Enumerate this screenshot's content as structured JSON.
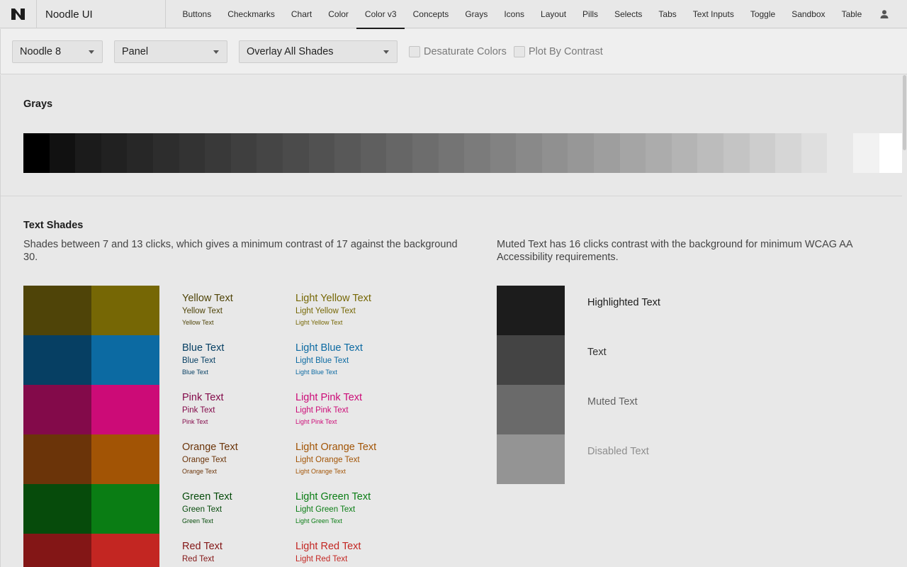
{
  "app": {
    "title": "Noodle UI",
    "logo_icon": "noodle-logo-icon"
  },
  "nav": {
    "tabs": [
      "Buttons",
      "Checkmarks",
      "Chart",
      "Color",
      "Color v3",
      "Concepts",
      "Grays",
      "Icons",
      "Layout",
      "Pills",
      "Selects",
      "Tabs",
      "Text Inputs",
      "Toggle",
      "Sandbox",
      "Table"
    ],
    "active": "Color v3",
    "user_icon": "user-icon"
  },
  "toolbar": {
    "theme_select": "Noodle 8",
    "surface_select": "Panel",
    "overlay_select": "Overlay All Shades",
    "desaturate_label": "Desaturate Colors",
    "desaturate_checked": false,
    "plot_label": "Plot By Contrast",
    "plot_checked": false
  },
  "grays": {
    "heading": "Grays",
    "shades": [
      "#000000",
      "#111111",
      "#1b1b1b",
      "#212121",
      "#272727",
      "#2d2d2d",
      "#333333",
      "#393939",
      "#3f3f3f",
      "#454545",
      "#4b4b4b",
      "#515151",
      "#585858",
      "#5f5f5f",
      "#666666",
      "#6d6d6d",
      "#747474",
      "#7b7b7b",
      "#828282",
      "#898989",
      "#909090",
      "#979797",
      "#9e9e9e",
      "#a5a5a5",
      "#acacac",
      "#b4b4b4",
      "#bcbcbc",
      "#c4c4c4",
      "#cdcdcd",
      "#d6d6d6",
      "#dfdfdf",
      "gap",
      "#f2f2f2",
      "#ffffff"
    ]
  },
  "text_shades": {
    "heading": "Text Shades",
    "description": "Shades between 7 and 13 clicks, which gives a minimum contrast of 17 against the background 30.",
    "muted_description": "Muted Text has 16 clicks contrast with the background for minimum WCAG AA Accessibility requirements.",
    "colors": [
      {
        "dark": "#4f4408",
        "light": "#766705",
        "text": "Yellow Text",
        "light_text": "Light Yellow Text"
      },
      {
        "dark": "#063f63",
        "light": "#0c6aa2",
        "text": "Blue Text",
        "light_text": "Light Blue Text"
      },
      {
        "dark": "#830a4a",
        "light": "#cc0b77",
        "text": "Pink Text",
        "light_text": "Light Pink Text"
      },
      {
        "dark": "#6b3409",
        "light": "#a25405",
        "text": "Orange Text",
        "light_text": "Light Orange Text"
      },
      {
        "dark": "#064b0b",
        "light": "#0a7d14",
        "text": "Green Text",
        "light_text": "Light Green Text"
      },
      {
        "dark": "#831616",
        "light": "#c32622",
        "text": "Red Text",
        "light_text": "Light Red Text"
      }
    ],
    "muted": [
      {
        "swatch": "#1c1c1c",
        "label": "Highlighted Text",
        "color": "#1c1c1c"
      },
      {
        "swatch": "#444444",
        "label": "Text",
        "color": "#333333"
      },
      {
        "swatch": "#6a6a6a",
        "label": "Muted Text",
        "color": "#626262"
      },
      {
        "swatch": "#949494",
        "label": "Disabled Text",
        "color": "#8e8e8e"
      }
    ]
  }
}
